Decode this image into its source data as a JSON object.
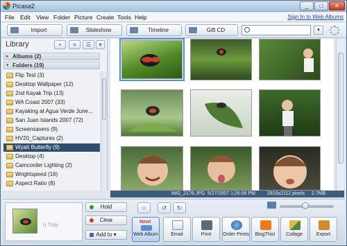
{
  "window": {
    "title": "Picasa2",
    "min_label": "_",
    "max_label": "□",
    "close_label": "✕"
  },
  "menu": {
    "items": [
      "File",
      "Edit",
      "View",
      "Folder",
      "Picture",
      "Create",
      "Tools",
      "Help"
    ],
    "signin": "Sign In to Web Albums"
  },
  "toolbar": {
    "import_label": "Import",
    "slideshow_label": "Slideshow",
    "timeline_label": "Timeline",
    "giftcd_label": "Gift CD",
    "search_value": "",
    "dropdown_icon": "chevron-down-icon"
  },
  "library": {
    "title": "Library",
    "albums_label": "Albums (2)",
    "folders_label": "Folders (19)",
    "folders": [
      {
        "label": "Flip Test (3)",
        "selected": false
      },
      {
        "label": "Desktop Wallpaper (12)",
        "selected": false
      },
      {
        "label": "2nd Kayak Trip (13)",
        "selected": false
      },
      {
        "label": "WA Coast 2007 (33)",
        "selected": false
      },
      {
        "label": "Kayaking at Agua Verde June...",
        "selected": false
      },
      {
        "label": "San Juan Islands 2007 (72)",
        "selected": false
      },
      {
        "label": "Screensavers (9)",
        "selected": false
      },
      {
        "label": "HV20_Captures (2)",
        "selected": false
      },
      {
        "label": "Wyatt Butterfly (9)",
        "selected": true
      },
      {
        "label": "Desktop (4)",
        "selected": false
      },
      {
        "label": "Camcorder Lighting (2)",
        "selected": false
      },
      {
        "label": "Wrightspeed (16)",
        "selected": false
      },
      {
        "label": "Aspect Ratio (8)",
        "selected": false
      }
    ]
  },
  "status": {
    "filename": "IMG_2178.JPG",
    "datetime": "5/27/2007 1:26:06 PM",
    "dimensions": "2816x2112 pixels",
    "size": "2.7MB"
  },
  "tray": {
    "text": "o Tray",
    "hold_label": "Hold",
    "clear_label": "Clear",
    "addto_label": "Add to",
    "actions": [
      {
        "label": "Web Album",
        "badge": "New!"
      },
      {
        "label": "Email"
      },
      {
        "label": "Print"
      },
      {
        "label": "Order Prints"
      },
      {
        "label": "BlogThis!"
      },
      {
        "label": "Collage"
      },
      {
        "label": "Export"
      }
    ]
  }
}
